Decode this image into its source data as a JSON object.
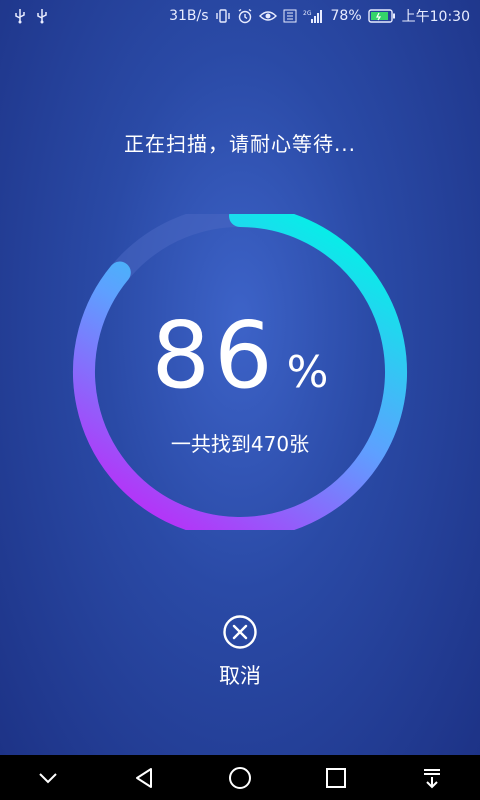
{
  "status_bar": {
    "speed": "31B/s",
    "network_type": "2G",
    "battery": "78%",
    "time": "上午10:30",
    "icons": [
      "usb-icon",
      "usb-icon",
      "vibrate-icon",
      "alarm-icon",
      "eye-icon",
      "signal-icon",
      "battery-icon"
    ]
  },
  "scan": {
    "message": "正在扫描，请耐心等待...",
    "percent": "86",
    "percent_sign": "%",
    "progress": 0.86,
    "found_text": "一共找到470张"
  },
  "cancel": {
    "label": "取消",
    "icon": "close-circle-icon"
  },
  "colors": {
    "ring_start": "#00f4e6",
    "ring_mid": "#5ea0ff",
    "ring_end": "#bb2bf7",
    "ring_track": "#4a67c2"
  },
  "nav_bar": {
    "icons": [
      "chevron-down-icon",
      "back-icon",
      "home-icon",
      "recents-icon",
      "notification-pull-icon"
    ]
  }
}
